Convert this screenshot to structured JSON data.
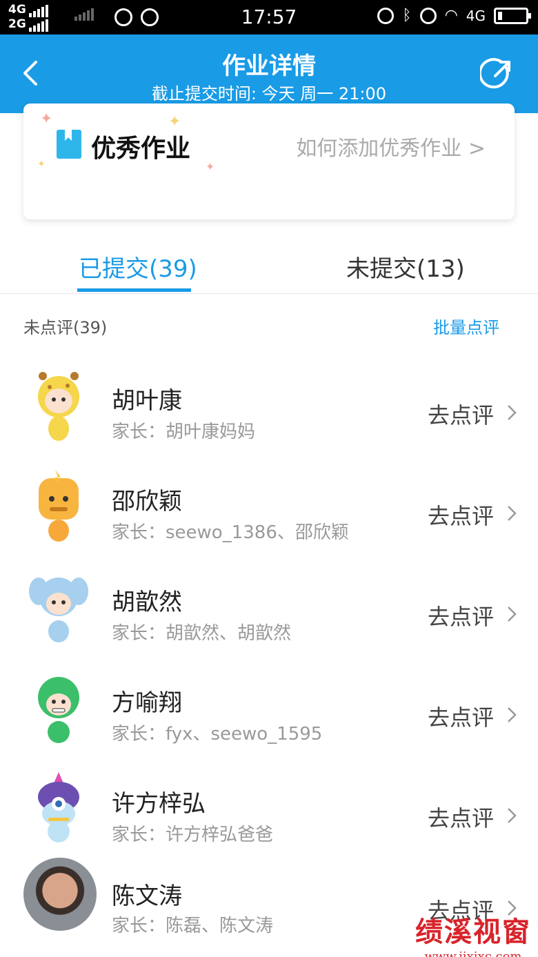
{
  "status_bar": {
    "net_top": "4G",
    "net_bottom": "2G",
    "time": "17:57",
    "net_right": "4G"
  },
  "header": {
    "title": "作业详情",
    "subtitle": "截止提交时间: 今天 周一 21:00",
    "color": "#1a9be6"
  },
  "card": {
    "title": "优秀作业",
    "link": "如何添加优秀作业 >"
  },
  "tabs": [
    {
      "label": "已提交(39)",
      "active": true
    },
    {
      "label": "未提交(13)",
      "active": false
    }
  ],
  "section": {
    "label": "未点评(39)",
    "batch_action": "批量点评"
  },
  "students": [
    {
      "name": "胡叶康",
      "parent": "家长：胡叶康妈妈",
      "action": "去点评",
      "avatar": "giraffe-avatar"
    },
    {
      "name": "邵欣颖",
      "parent": "家长：seewo_1386、邵欣颖",
      "action": "去点评",
      "avatar": "tiger-avatar"
    },
    {
      "name": "胡歆然",
      "parent": "家长：胡歆然、胡歆然",
      "action": "去点评",
      "avatar": "elephant-avatar"
    },
    {
      "name": "方喻翔",
      "parent": "家长：fyx、seewo_1595",
      "action": "去点评",
      "avatar": "dino-avatar"
    },
    {
      "name": "许方梓弘",
      "parent": "家长：许方梓弘爸爸",
      "action": "去点评",
      "avatar": "monster-avatar"
    },
    {
      "name": "陈文涛",
      "parent": "家长：陈磊、陈文涛",
      "action": "去点评",
      "avatar": "photo-avatar"
    }
  ],
  "watermark": {
    "text": "绩溪视窗",
    "url": "www.jixixc.com"
  }
}
